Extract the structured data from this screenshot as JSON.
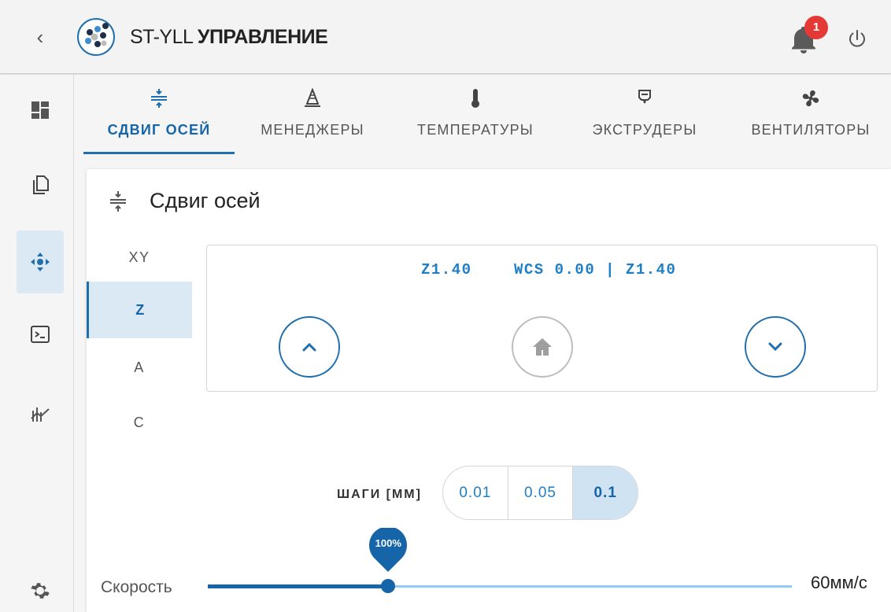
{
  "header": {
    "title_prefix": "ST-YLL",
    "title_main": "УПРАВЛЕНИЕ",
    "notification_count": "1",
    "icons": [
      "chevron-left-icon",
      "logo-icon",
      "bell-icon",
      "power-icon"
    ]
  },
  "sidebar": {
    "items": [
      {
        "name": "dashboard-icon"
      },
      {
        "name": "files-icon"
      },
      {
        "name": "move-icon",
        "active": true
      },
      {
        "name": "console-icon"
      },
      {
        "name": "chart-icon"
      }
    ],
    "settings_icon": "gear-icon"
  },
  "tabs": [
    {
      "label": "СДВИГ ОСЕЙ",
      "icon": "axis-shift-icon",
      "active": true
    },
    {
      "label": "МЕНЕДЖЕРЫ",
      "icon": "manager-icon"
    },
    {
      "label": "ТЕМПЕРАТУРЫ",
      "icon": "thermometer-icon"
    },
    {
      "label": "ЭКСТРУДЕРЫ",
      "icon": "extruder-icon"
    },
    {
      "label": "ВЕНТИЛЯТОРЫ",
      "icon": "fan-icon"
    }
  ],
  "card": {
    "title": "Сдвиг осей",
    "axes": [
      "XY",
      "Z",
      "A",
      "C"
    ],
    "active_axis": "Z",
    "position": "Z1.40",
    "wcs": "WCS 0.00 | Z1.40",
    "steps_label": "ШАГИ [ММ]",
    "steps": [
      "0.01",
      "0.05",
      "0.1"
    ],
    "active_step": "0.1",
    "speed_label": "Скорость",
    "speed_percent": "100%",
    "speed_fraction": 0.309,
    "speed_value": "60мм/с"
  },
  "colors": {
    "accent": "#1f6fae",
    "accent_light": "#dbe9f5",
    "badge": "#e53935"
  }
}
